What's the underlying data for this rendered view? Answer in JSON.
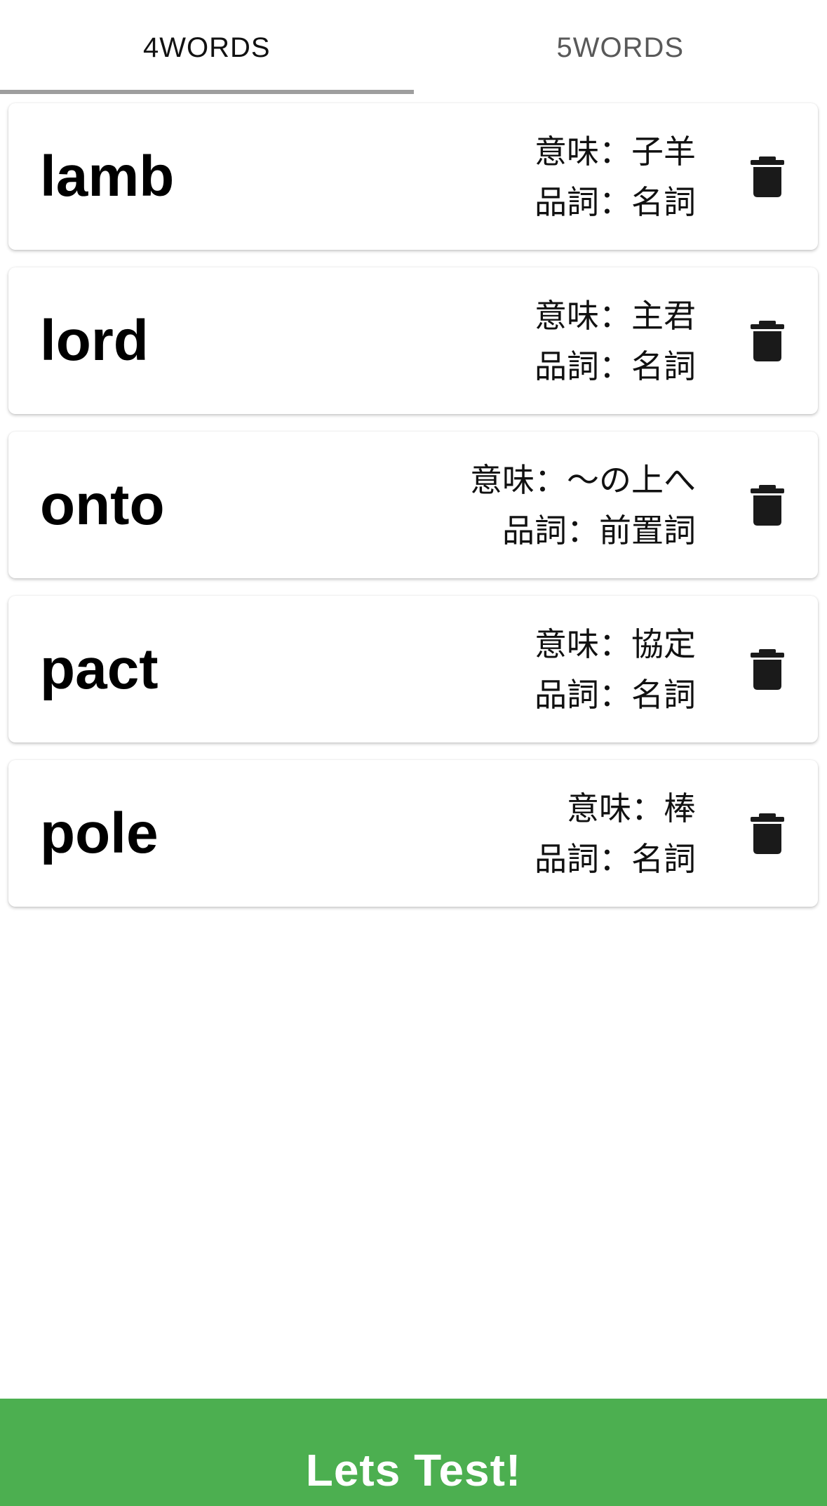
{
  "tabs": [
    {
      "label": "4WORDS",
      "active": true
    },
    {
      "label": "5WORDS",
      "active": false
    }
  ],
  "cards": [
    {
      "word": "lamb",
      "meaning": "意味：子羊",
      "pos": "品詞：名詞"
    },
    {
      "word": "lord",
      "meaning": "意味：主君",
      "pos": "品詞：名詞"
    },
    {
      "word": "onto",
      "meaning": "意味：〜の上へ",
      "pos": "品詞：前置詞"
    },
    {
      "word": "pact",
      "meaning": "意味：協定",
      "pos": "品詞：名詞"
    },
    {
      "word": "pole",
      "meaning": "意味：棒",
      "pos": "品詞：名詞"
    }
  ],
  "icons": {
    "delete": "trash-icon"
  },
  "cta": {
    "label": "Lets Test!"
  },
  "colors": {
    "accent": "#4caf50",
    "tab_indicator": "#9e9e9e",
    "icon": "#1a1a1a"
  }
}
